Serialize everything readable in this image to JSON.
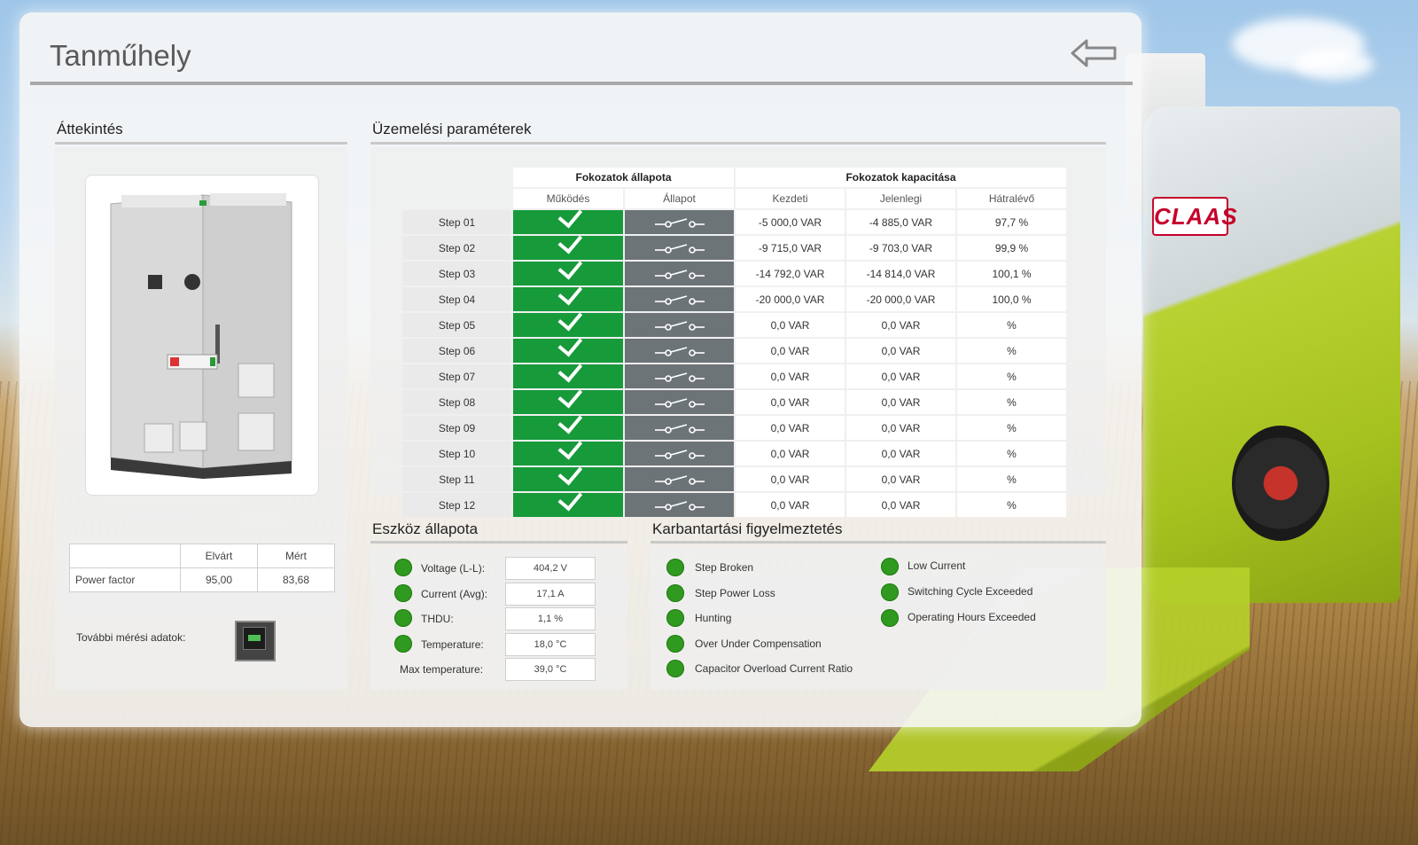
{
  "header": {
    "title": "Tanműhely"
  },
  "overview": {
    "title": "Áttekintés",
    "pf_table": {
      "headers": [
        "",
        "Elvárt",
        "Mért"
      ],
      "row": {
        "label": "Power factor",
        "expected": "95,00",
        "measured": "83,68"
      }
    },
    "more_label": "További mérési adatok:"
  },
  "params": {
    "title": "Üzemelési paraméterek",
    "group1": "Fokozatok állapota",
    "group2": "Fokozatok kapacitása",
    "sub_headers": [
      "Működés",
      "Állapot",
      "Kezdeti",
      "Jelenlegi",
      "Hátralévő"
    ],
    "rows": [
      {
        "step": "Step 01",
        "initial": "-5 000,0 VAR",
        "current": "-4 885,0 VAR",
        "remaining": "97,7 %"
      },
      {
        "step": "Step 02",
        "initial": "-9 715,0 VAR",
        "current": "-9 703,0 VAR",
        "remaining": "99,9 %"
      },
      {
        "step": "Step 03",
        "initial": "-14 792,0 VAR",
        "current": "-14 814,0 VAR",
        "remaining": "100,1 %"
      },
      {
        "step": "Step 04",
        "initial": "-20 000,0 VAR",
        "current": "-20 000,0 VAR",
        "remaining": "100,0 %"
      },
      {
        "step": "Step 05",
        "initial": "0,0 VAR",
        "current": "0,0 VAR",
        "remaining": "%"
      },
      {
        "step": "Step 06",
        "initial": "0,0 VAR",
        "current": "0,0 VAR",
        "remaining": "%"
      },
      {
        "step": "Step 07",
        "initial": "0,0 VAR",
        "current": "0,0 VAR",
        "remaining": "%"
      },
      {
        "step": "Step 08",
        "initial": "0,0 VAR",
        "current": "0,0 VAR",
        "remaining": "%"
      },
      {
        "step": "Step 09",
        "initial": "0,0 VAR",
        "current": "0,0 VAR",
        "remaining": "%"
      },
      {
        "step": "Step 10",
        "initial": "0,0 VAR",
        "current": "0,0 VAR",
        "remaining": "%"
      },
      {
        "step": "Step 11",
        "initial": "0,0 VAR",
        "current": "0,0 VAR",
        "remaining": "%"
      },
      {
        "step": "Step 12",
        "initial": "0,0 VAR",
        "current": "0,0 VAR",
        "remaining": "%"
      }
    ]
  },
  "device": {
    "title": "Eszköz állapota",
    "items": [
      {
        "label": "Voltage (L-L):",
        "value": "404,2 V"
      },
      {
        "label": "Current (Avg):",
        "value": "17,1 A"
      },
      {
        "label": "THDU:",
        "value": "1,1 %"
      },
      {
        "label": "Temperature:",
        "value": "18,0 °C"
      },
      {
        "label": "Max temperature:",
        "value": "39,0 °C"
      }
    ]
  },
  "maintenance": {
    "title": "Karbantartási figyelmeztetés",
    "left": [
      "Step Broken",
      "Step Power Loss",
      "Hunting",
      "Over Under Compensation",
      "Capacitor Overload Current Ratio"
    ],
    "right": [
      "Low Current",
      "Switching Cycle Exceeded",
      "Operating Hours Exceeded"
    ]
  },
  "colors": {
    "ok_green": "#169a3a",
    "switch_gray": "#6d7478",
    "status_green": "#2f9a1f"
  }
}
